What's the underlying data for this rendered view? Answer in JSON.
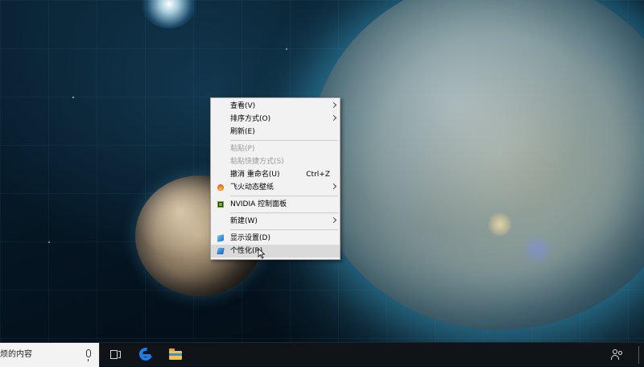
{
  "desktop": {
    "wallpaper": "space-planets",
    "accent_color": "#5bc8f0"
  },
  "context_menu": {
    "items": [
      {
        "label": "查看(V)",
        "submenu": true,
        "state": "normal"
      },
      {
        "label": "排序方式(O)",
        "submenu": true,
        "state": "normal"
      },
      {
        "label": "刷新(E)",
        "state": "normal"
      },
      {
        "label": "粘贴(P)",
        "state": "disabled"
      },
      {
        "label": "粘贴快捷方式(S)",
        "state": "disabled"
      },
      {
        "label": "撤消 重命名(U)",
        "shortcut": "Ctrl+Z",
        "state": "normal"
      },
      {
        "label": "飞火动态壁纸",
        "icon": "fire-icon",
        "submenu": true,
        "state": "normal"
      },
      {
        "label": "NVIDIA 控制面板",
        "icon": "nvidia-icon",
        "state": "normal"
      },
      {
        "label": "新建(W)",
        "submenu": true,
        "state": "normal"
      },
      {
        "label": "显示设置(D)",
        "icon": "display-icon",
        "state": "normal"
      },
      {
        "label": "个性化(R)",
        "icon": "personalize-icon",
        "state": "highlighted"
      }
    ],
    "highlight_color": "#dadada",
    "background_color": "#f2f2f2"
  },
  "taskbar": {
    "search_text": "烦的内容",
    "buttons": [
      {
        "name": "task-view-icon"
      },
      {
        "name": "edge-icon"
      },
      {
        "name": "file-explorer-icon"
      }
    ],
    "tray": [
      "people-icon"
    ],
    "background_color": "#101418"
  }
}
